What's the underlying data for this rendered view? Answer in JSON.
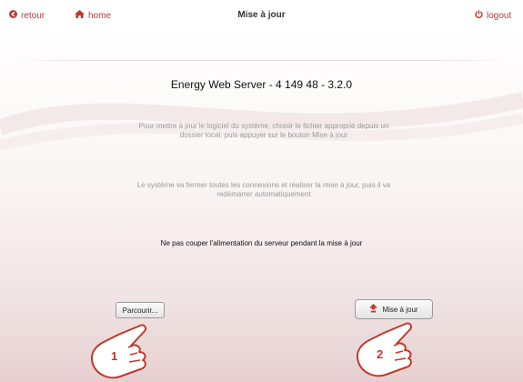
{
  "header": {
    "back_label": "retour",
    "home_label": "home",
    "title": "Mise à jour",
    "logout_label": "logout"
  },
  "main": {
    "server_name": "Energy Web Server - 4 149 48 - 3.2.0",
    "instruction_line1": "Pour mettre à jour le logiciel du système, choisir le fichier approprié depuis un",
    "instruction_line2": "dossier local, puis appuyer sur le bouton Mise à jour",
    "notice_line1": "Le système va fermer toutes les connexions et réaliser la mise à jour, puis il va",
    "notice_line2": "redémarrer automatiquement",
    "warning": "Ne pas couper l'alimentation du serveur pendant la mise à jour"
  },
  "actions": {
    "browse_label": "Parcourir...",
    "update_label": "Mise à jour"
  },
  "annotations": {
    "step1": "1",
    "step2": "2"
  },
  "icons": {
    "back": "back-arrow-circle-icon",
    "home": "home-icon",
    "logout": "power-icon",
    "update": "upload-arrow-icon",
    "pointer": "hand-pointer-icon"
  },
  "colors": {
    "accent": "#b23a3a",
    "text_muted": "#9a9a9a"
  }
}
